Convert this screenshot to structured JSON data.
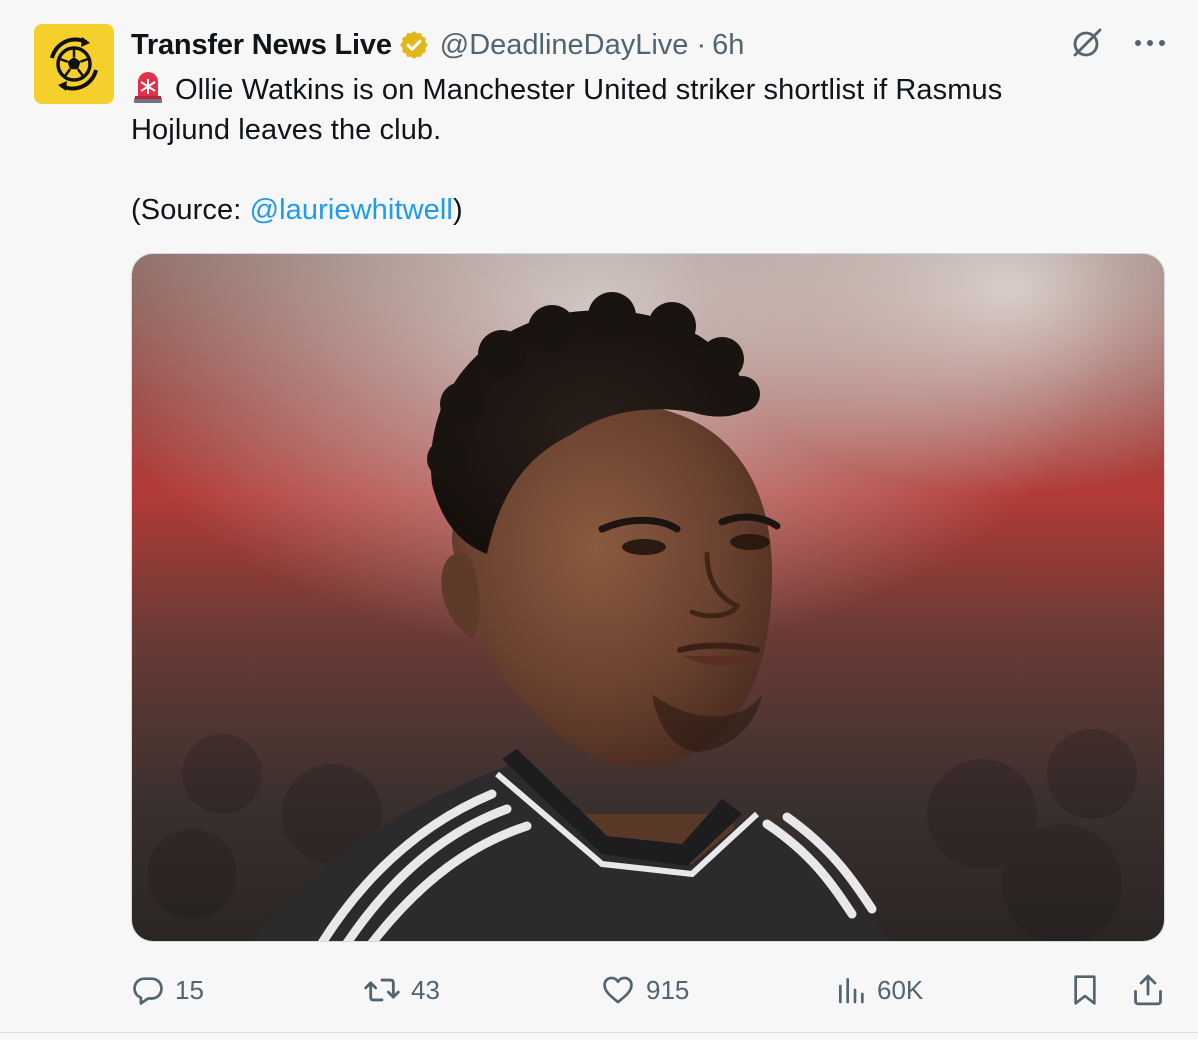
{
  "author": {
    "display_name": "Transfer News Live",
    "handle": "@DeadlineDayLive",
    "separator": "·",
    "time": "6h",
    "verified": true,
    "avatar_icon": "soccer-ball-logo",
    "avatar_color": "#f5cf2c"
  },
  "tweet": {
    "line_emoji": "siren-emoji",
    "text_line1": "Ollie Watkins is on Manchester United striker shortlist if Rasmus",
    "text_line2": "Hojlund leaves the club.",
    "source_prefix": "(Source: ",
    "source_mention": "@lauriewhitwell",
    "source_suffix": ")"
  },
  "top_actions": {
    "grok_icon": "grok-icon",
    "more_icon": "more-dots-icon"
  },
  "media": {
    "kind": "photo",
    "subject": "footballer portrait in dark kit with white stripes"
  },
  "actions": {
    "replies": "15",
    "retweets": "43",
    "likes": "915",
    "views": "60K"
  },
  "colors": {
    "background": "#f7f7f7",
    "text": "#0f1419",
    "secondary": "#536471",
    "link": "#1d9bf0",
    "verified": "#e2b719"
  }
}
